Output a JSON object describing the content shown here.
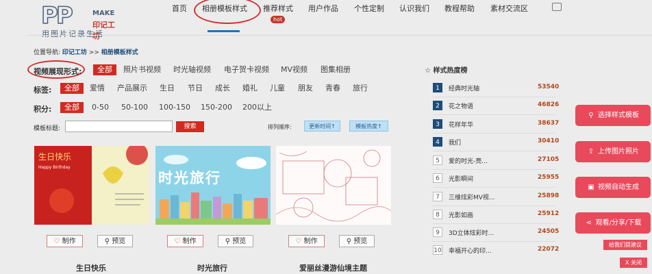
{
  "logo": {
    "mark": "PP",
    "make": "MAKE",
    "brand": "印记工坊",
    "slogan": "用图片记录生活"
  },
  "nav": {
    "items": [
      "首页",
      "相册模板样式",
      "推荐样式",
      "用户作品",
      "个性定制",
      "认识我们",
      "教程帮助",
      "素材交流区"
    ],
    "hot_badge": "hot",
    "active_index": 1
  },
  "breadcrumb": {
    "prefix": "位置导航:",
    "home": "印记工坊",
    "sep": ">>",
    "current": "相册模板样式"
  },
  "filters": {
    "format": {
      "label": "视频展现形式:",
      "options": [
        "全部",
        "照片书视频",
        "时光轴视频",
        "电子贺卡视频",
        "MV视频",
        "图集相册"
      ]
    },
    "tags": {
      "label": "标签:",
      "options": [
        "全部",
        "爱情",
        "产品展示",
        "生日",
        "节日",
        "成长",
        "婚礼",
        "儿童",
        "朋友",
        "青春",
        "旅行"
      ]
    },
    "points": {
      "label": "积分:",
      "options": [
        "全部",
        "0-50",
        "50-100",
        "100-150",
        "150-200",
        "200以上"
      ]
    }
  },
  "search": {
    "label": "模板标题:",
    "value": "",
    "button": "搜索"
  },
  "sort": {
    "label": "排列顺序:",
    "options": [
      "更新时间↑",
      "模板热度↑"
    ]
  },
  "templates": [
    {
      "title": "生日快乐",
      "make": "制作",
      "preview": "预览",
      "image_text": "生日快乐",
      "image_subtext": "Happy Birthday"
    },
    {
      "title": "时光旅行",
      "make": "制作",
      "preview": "预览",
      "image_text": "时光旅行"
    },
    {
      "title": "爱丽丝漫游仙境主题",
      "make": "制作",
      "preview": "预览"
    }
  ],
  "ranking": {
    "title": "样式热度榜",
    "items": [
      {
        "rank": "1",
        "name": "经典时光轴",
        "value": "53540"
      },
      {
        "rank": "2",
        "name": "花之物语",
        "value": "46826"
      },
      {
        "rank": "3",
        "name": "花样年华",
        "value": "38637"
      },
      {
        "rank": "4",
        "name": "我们",
        "value": "30410"
      },
      {
        "rank": "5",
        "name": "爱的时光-亮...",
        "value": "27105"
      },
      {
        "rank": "6",
        "name": "光影瞬间",
        "value": "25955"
      },
      {
        "rank": "7",
        "name": "三维炫彩MV视...",
        "value": "25898"
      },
      {
        "rank": "8",
        "name": "光影如画",
        "value": "25912"
      },
      {
        "rank": "9",
        "name": "3D立体炫彩时...",
        "value": "24505"
      },
      {
        "rank": "10",
        "name": "幸福开心的印...",
        "value": "22072"
      }
    ]
  },
  "side_tools": [
    {
      "label": "选择样式模板",
      "icon": "search-icon"
    },
    {
      "label": "上传图片照片",
      "icon": "upload-icon"
    },
    {
      "label": "视频自动生成",
      "icon": "video-icon"
    },
    {
      "label": "观看/分享/下载",
      "icon": "share-icon"
    }
  ],
  "feedback": "给我们提建议",
  "close": "X 关闭",
  "colors": {
    "accent": "#d22a22",
    "navy": "#1e4d7a",
    "tool": "#e84a5b"
  }
}
